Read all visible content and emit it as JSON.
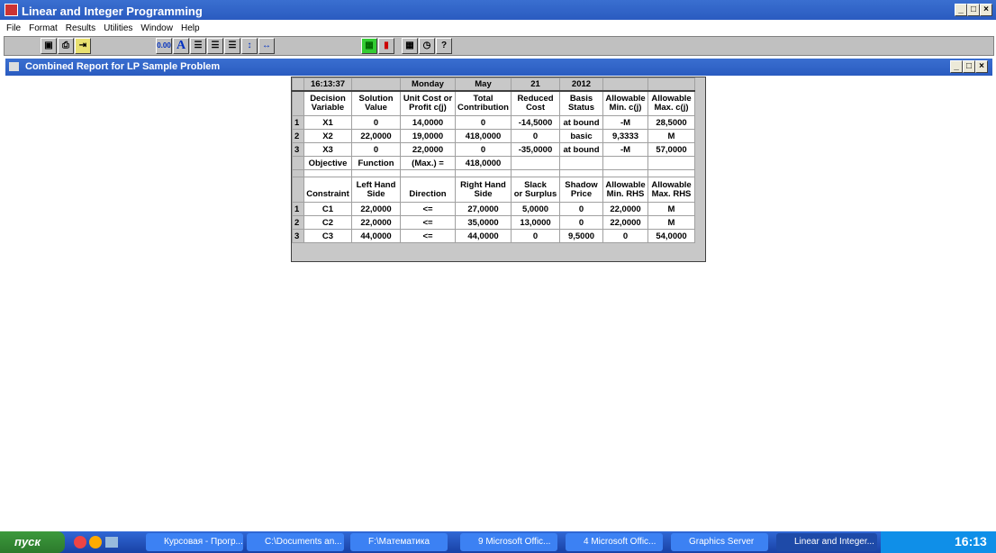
{
  "app": {
    "title": "Linear and Integer Programming"
  },
  "menu": [
    "File",
    "Format",
    "Results",
    "Utilities",
    "Window",
    "Help"
  ],
  "toolbar": {
    "decimal_label": "0.00",
    "font_label": "A",
    "help_label": "?"
  },
  "child": {
    "title": "Combined Report for LP Sample Problem"
  },
  "report": {
    "date_row": [
      "16:13:37",
      "",
      "Monday",
      "May",
      "21",
      "2012",
      "",
      ""
    ],
    "var_headers": [
      [
        "Decision",
        "Variable"
      ],
      [
        "Solution",
        "Value"
      ],
      [
        "Unit Cost or",
        "Profit c(j)"
      ],
      [
        "Total",
        "Contribution"
      ],
      [
        "Reduced",
        "Cost"
      ],
      [
        "Basis",
        "Status"
      ],
      [
        "Allowable",
        "Min. c(j)"
      ],
      [
        "Allowable",
        "Max. c(j)"
      ]
    ],
    "var_rows": [
      {
        "n": "1",
        "cells": [
          "X1",
          "0",
          "14,0000",
          "0",
          "-14,5000",
          "at bound",
          "-M",
          "28,5000"
        ]
      },
      {
        "n": "2",
        "cells": [
          "X2",
          "22,0000",
          "19,0000",
          "418,0000",
          "0",
          "basic",
          "9,3333",
          "M"
        ]
      },
      {
        "n": "3",
        "cells": [
          "X3",
          "0",
          "22,0000",
          "0",
          "-35,0000",
          "at bound",
          "-M",
          "57,0000"
        ]
      }
    ],
    "objective": [
      "Objective",
      "Function",
      "(Max.) =",
      "418,0000",
      "",
      "",
      "",
      ""
    ],
    "con_headers": [
      [
        "",
        "Constraint"
      ],
      [
        "Left Hand",
        "Side"
      ],
      [
        "",
        "Direction"
      ],
      [
        "Right Hand",
        "Side"
      ],
      [
        "Slack",
        "or Surplus"
      ],
      [
        "Shadow",
        "Price"
      ],
      [
        "Allowable",
        "Min. RHS"
      ],
      [
        "Allowable",
        "Max. RHS"
      ]
    ],
    "con_rows": [
      {
        "n": "1",
        "cells": [
          "C1",
          "22,0000",
          "<=",
          "27,0000",
          "5,0000",
          "0",
          "22,0000",
          "M"
        ]
      },
      {
        "n": "2",
        "cells": [
          "C2",
          "22,0000",
          "<=",
          "35,0000",
          "13,0000",
          "0",
          "22,0000",
          "M"
        ]
      },
      {
        "n": "3",
        "cells": [
          "C3",
          "44,0000",
          "<=",
          "44,0000",
          "0",
          "9,5000",
          "0",
          "54,0000"
        ]
      }
    ]
  },
  "taskbar": {
    "start": "пуск",
    "tasks": [
      "Курсовая - Прогр...",
      "C:\\Documents an...",
      "F:\\Математика",
      "9 Microsoft Offic...",
      "4 Microsoft Offic...",
      "Graphics Server",
      "Linear and Integer..."
    ],
    "clock": "16:13"
  }
}
